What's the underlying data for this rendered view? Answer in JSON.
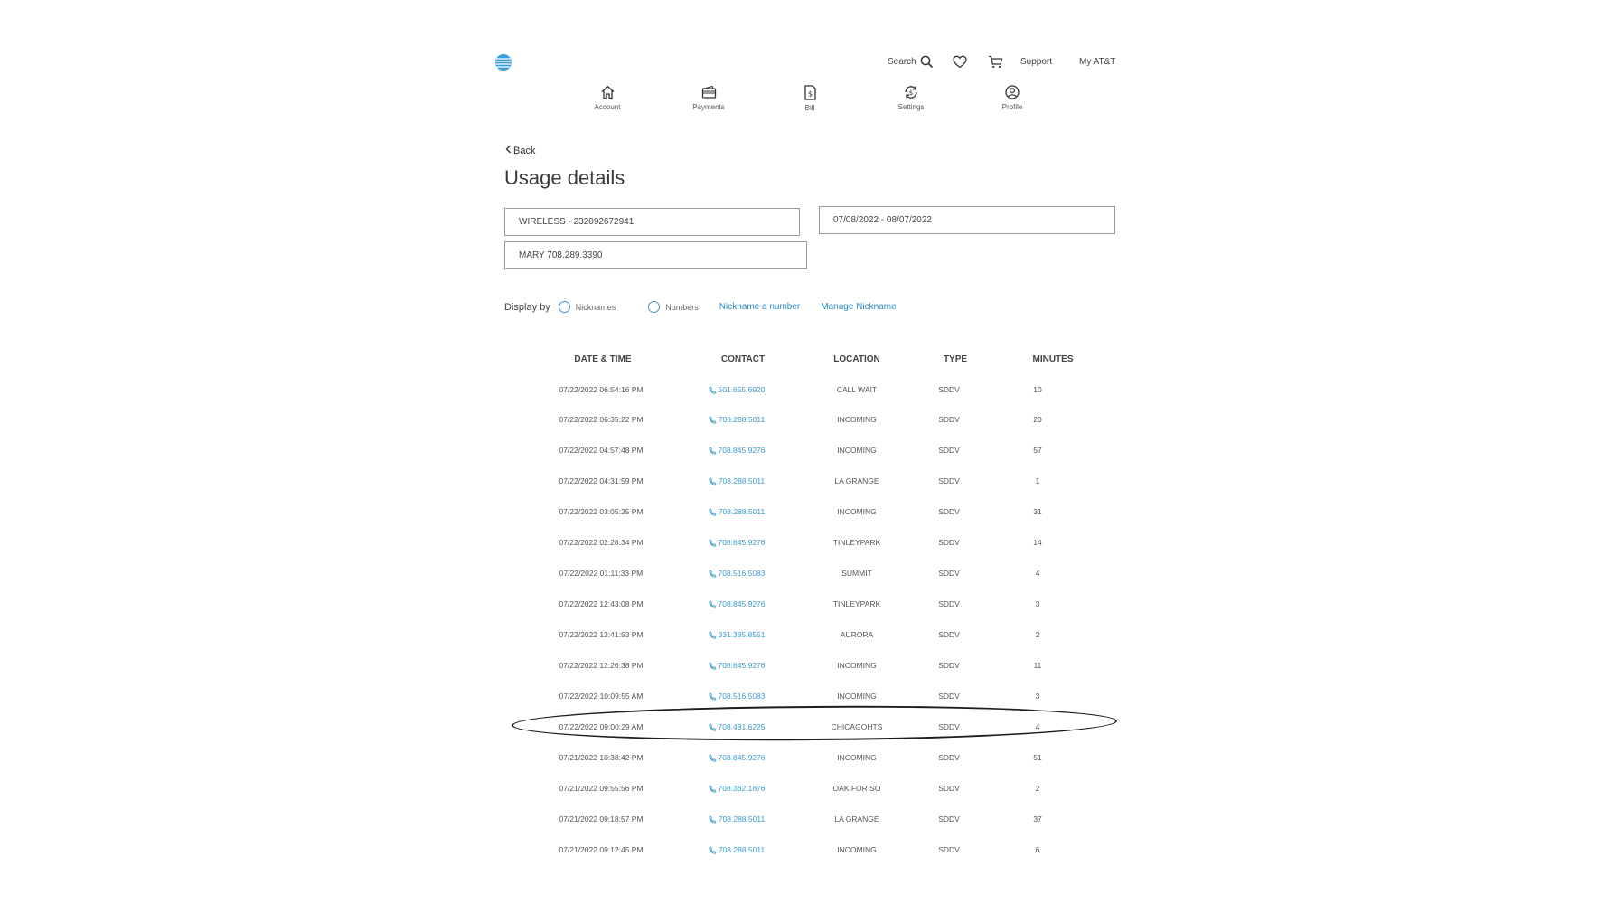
{
  "header": {
    "search_label": "Search",
    "support_label": "Support",
    "myatt_label": "My AT&T"
  },
  "nav": {
    "items": [
      {
        "label": "Account",
        "icon": "home-icon"
      },
      {
        "label": "Payments",
        "icon": "wallet-icon"
      },
      {
        "label": "Bill",
        "icon": "bill-icon"
      },
      {
        "label": "Settings",
        "icon": "settings-icon"
      },
      {
        "label": "Profile",
        "icon": "profile-icon"
      }
    ]
  },
  "page": {
    "back_label": "Back",
    "title": "Usage details"
  },
  "filters": {
    "account": "WIRELESS - 232092672941",
    "date_range": "07/08/2022 - 08/07/2022",
    "line": "MARY 708.289.3390"
  },
  "display_by": {
    "label": "Display by",
    "option_nicknames": "Nicknames",
    "option_numbers": "Numbers",
    "link_nickname": "Nickname a number",
    "link_manage": "Manage Nickname"
  },
  "table": {
    "headers": [
      "DATE & TIME",
      "CONTACT",
      "LOCATION",
      "TYPE",
      "MINUTES"
    ],
    "rows": [
      [
        "07/22/2022 06:54:16 PM",
        "501.655.6920",
        "CALL WAIT",
        "SDDV",
        "10"
      ],
      [
        "07/22/2022 06:35:22 PM",
        "708.288.5011",
        "INCOMING",
        "SDDV",
        "20"
      ],
      [
        "07/22/2022 04:57:48 PM",
        "708.845.9276",
        "INCOMING",
        "SDDV",
        "57"
      ],
      [
        "07/22/2022 04:31:59 PM",
        "708.288.5011",
        "LA GRANGE",
        "SDDV",
        "1"
      ],
      [
        "07/22/2022 03:05:25 PM",
        "708.288.5011",
        "INCOMING",
        "SDDV",
        "31"
      ],
      [
        "07/22/2022 02:28:34 PM",
        "708.845.9276",
        "TINLEYPARK",
        "SDDV",
        "14"
      ],
      [
        "07/22/2022 01:11:33 PM",
        "708.516.5083",
        "SUMMIT",
        "SDDV",
        "4"
      ],
      [
        "07/22/2022 12:43:08 PM",
        "708.845.9276",
        "TINLEYPARK",
        "SDDV",
        "3"
      ],
      [
        "07/22/2022 12:41:53 PM",
        "331.385.8551",
        "AURORA",
        "SDDV",
        "2"
      ],
      [
        "07/22/2022 12:26:38 PM",
        "708.845.9276",
        "INCOMING",
        "SDDV",
        "11"
      ],
      [
        "07/22/2022 10:09:55 AM",
        "708.516.5083",
        "INCOMING",
        "SDDV",
        "3"
      ],
      [
        "07/22/2022 09:00:29 AM",
        "708.481.6225",
        "CHICAGOHTS",
        "SDDV",
        "4"
      ],
      [
        "07/21/2022 10:38:42 PM",
        "708.845.9276",
        "INCOMING",
        "SDDV",
        "51"
      ],
      [
        "07/21/2022 09:55:56 PM",
        "708.382.1876",
        "OAK FOR SO",
        "SDDV",
        "2"
      ],
      [
        "07/21/2022 09:18:57 PM",
        "708.288.5011",
        "LA GRANGE",
        "SDDV",
        "37"
      ],
      [
        "07/21/2022 09:12:45 PM",
        "708.288.5011",
        "INCOMING",
        "SDDV",
        "6"
      ]
    ]
  },
  "colors": {
    "link": "#2a8cc8",
    "brand": "#3a9fd8",
    "circle_annotation": "#1e1e1e"
  }
}
